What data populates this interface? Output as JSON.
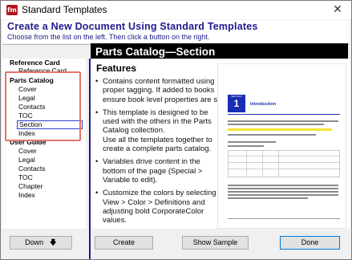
{
  "window": {
    "title": "Standard Templates",
    "app_icon_label": "fm"
  },
  "header": {
    "title": "Create a New Document Using Standard Templates",
    "subtitle": "Choose from the list on the left. Then click a button on the right."
  },
  "tree": {
    "groups": [
      {
        "label": "Reference Card",
        "items": [
          "Reference Card"
        ]
      },
      {
        "label": "Parts Catalog",
        "items": [
          "Cover",
          "Legal",
          "Contacts",
          "TOC",
          "Section",
          "Index"
        ]
      },
      {
        "label": "User Guide",
        "items": [
          "Cover",
          "Legal",
          "Contacts",
          "TOC",
          "Chapter",
          "Index"
        ]
      }
    ],
    "selected": "Section"
  },
  "content": {
    "section_title": "Parts Catalog—Section",
    "features_title": "Features",
    "bullets": [
      [
        "Contains content formatted using",
        "proper tagging. If added to books",
        "ensure book level properties are set."
      ],
      [
        "This template is designed to be",
        "used with the others in the Parts",
        "Catalog collection.",
        "Use all the templates together to",
        "create a complete parts catalog."
      ],
      [
        "Variables drive content in the",
        "bottom of the page (Special >",
        "Variable to edit)."
      ],
      [
        "Customize the colors by selecting",
        "View > Color > Definitions and",
        "adjusting bold CorporateColor",
        "values."
      ]
    ]
  },
  "preview": {
    "badge_label": "SECTION",
    "badge_number": "1",
    "heading": "Introduction"
  },
  "buttons": {
    "down": "Down",
    "down_icon": "down-arrow-icon",
    "create": "Create",
    "show_sample": "Show Sample",
    "done": "Done"
  },
  "colors": {
    "header_text": "#1f1a8c",
    "selection_border": "#2a3fd0",
    "highlight_box": "#e3756b",
    "preview_accent": "#1a2db4"
  }
}
